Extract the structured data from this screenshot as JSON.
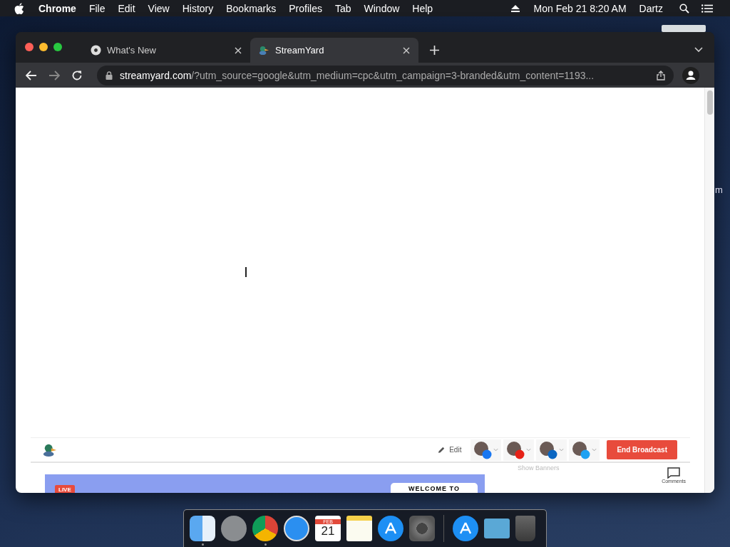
{
  "menu_bar": {
    "app": "Chrome",
    "menus": [
      "File",
      "Edit",
      "View",
      "History",
      "Bookmarks",
      "Profiles",
      "Tab",
      "Window",
      "Help"
    ],
    "date_time": "Mon Feb 21  8:20 AM",
    "user": "Dartz"
  },
  "desktop": {
    "icon_label": "m"
  },
  "tabs": [
    {
      "title": "What's New",
      "kind": "chrome",
      "selected": false
    },
    {
      "title": "StreamYard",
      "kind": "streamyard",
      "selected": true
    }
  ],
  "address_bar": {
    "domain": "streamyard.com",
    "path": "/?utm_source=google&utm_medium=cpc&utm_campaign=3-branded&utm_content=1193..."
  },
  "studio": {
    "edit": "Edit",
    "destinations": [
      {
        "kind": "facebook"
      },
      {
        "kind": "youtube"
      },
      {
        "kind": "linkedin"
      },
      {
        "kind": "twitter"
      }
    ],
    "end_button": "End Broadcast",
    "banners": "Show Banners",
    "comments": "Comments",
    "live_badge": "LIVE",
    "welcome": "WELCOME TO"
  },
  "dock": [
    {
      "kind": "finder",
      "running": true
    },
    {
      "kind": "launchpad",
      "running": false
    },
    {
      "kind": "chrome",
      "running": true
    },
    {
      "kind": "safari",
      "running": false
    },
    {
      "kind": "calendar",
      "running": false,
      "month": "FEB",
      "day": "21"
    },
    {
      "kind": "notes",
      "running": false
    },
    {
      "kind": "appstore",
      "running": false
    },
    {
      "kind": "settings",
      "running": false
    },
    {
      "kind": "separator"
    },
    {
      "kind": "appstore",
      "running": false
    },
    {
      "kind": "folder",
      "running": false
    },
    {
      "kind": "trash",
      "running": false
    }
  ]
}
